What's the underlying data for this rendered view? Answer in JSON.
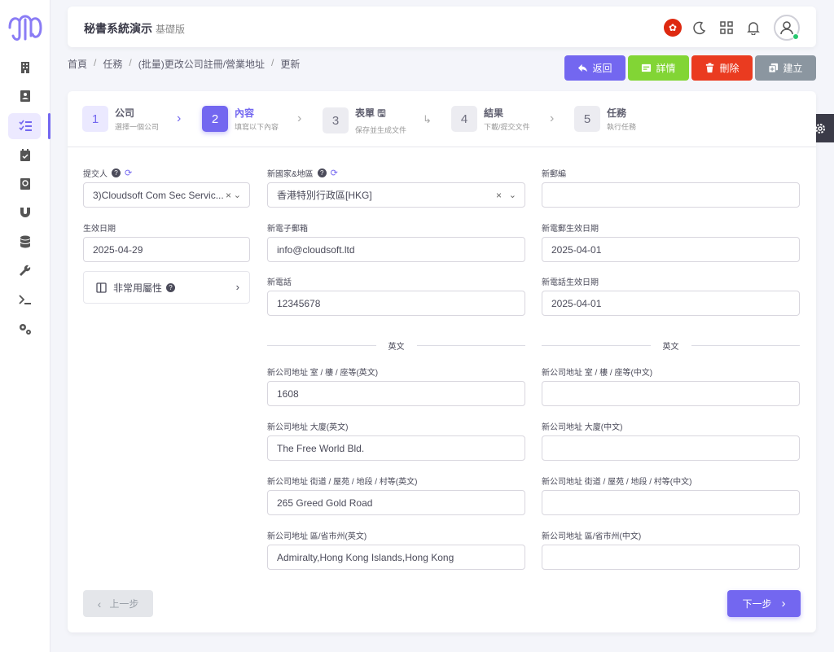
{
  "app": {
    "title": "秘書系統演示",
    "edition": "基礎版"
  },
  "breadcrumb": [
    "首頁",
    "任務",
    "(批量)更改公司註冊/營業地址",
    "更新"
  ],
  "actions": {
    "back": "返回",
    "detail": "詳情",
    "delete": "刪除",
    "create": "建立"
  },
  "steps": [
    {
      "num": "1",
      "title": "公司",
      "sub": "選擇一個公司"
    },
    {
      "num": "2",
      "title": "內容",
      "sub": "填寫以下內容"
    },
    {
      "num": "3",
      "title": "表單",
      "sub": "保存並生成文件"
    },
    {
      "num": "4",
      "title": "結果",
      "sub": "下載/提交文件"
    },
    {
      "num": "5",
      "title": "任務",
      "sub": "執行任務"
    }
  ],
  "form": {
    "submitter_label": "提交人",
    "submitter_value": "3)Cloudsoft Com Sec Servic...",
    "effective_date_label": "生效日期",
    "effective_date_value": "2025-04-29",
    "uncommon_attrs": "非常用屬性",
    "country_label": "新國家&地區",
    "country_value": "香港特別行政區[HKG]",
    "zip_label": "新郵編",
    "zip_value": "",
    "email_label": "新電子郵箱",
    "email_value": "info@cloudsoft.ltd",
    "email_date_label": "新電郵生效日期",
    "email_date_value": "2025-04-01",
    "phone_label": "新電話",
    "phone_value": "12345678",
    "phone_date_label": "新電話生效日期",
    "phone_date_value": "2025-04-01",
    "divider_en": "英文",
    "divider_zh": "英文",
    "room_en_label": "新公司地址 室 / 樓 / 座等(英文)",
    "room_en_value": "1608",
    "room_zh_label": "新公司地址 室 / 樓 / 座等(中文)",
    "room_zh_value": "",
    "building_en_label": "新公司地址 大廈(英文)",
    "building_en_value": "The Free World Bld.",
    "building_zh_label": "新公司地址 大廈(中文)",
    "building_zh_value": "",
    "street_en_label": "新公司地址 街道 / 屋苑 / 地段 / 村等(英文)",
    "street_en_value": "265 Greed Gold Road",
    "street_zh_label": "新公司地址 街道 / 屋苑 / 地段 / 村等(中文)",
    "street_zh_value": "",
    "district_en_label": "新公司地址 區/省市州(英文)",
    "district_en_value": "Admiralty,Hong Kong Islands,Hong Kong",
    "district_zh_label": "新公司地址 區/省市州(中文)",
    "district_zh_value": ""
  },
  "nav": {
    "prev": "上一步",
    "next": "下一步"
  },
  "colors": {
    "primary": "#7367f0",
    "success": "#82d535",
    "danger": "#ea3b20",
    "secondary": "#8b96a0"
  }
}
